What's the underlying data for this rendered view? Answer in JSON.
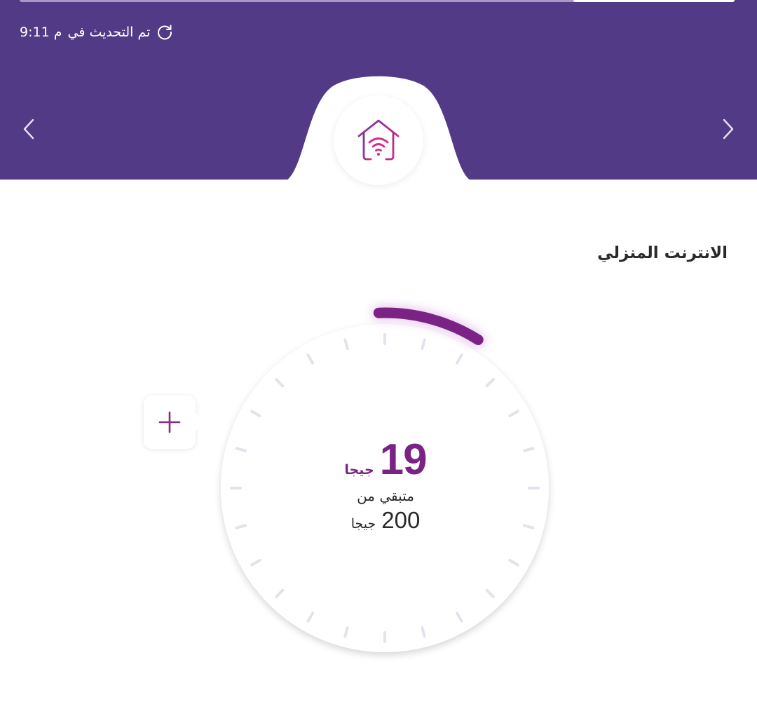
{
  "colors": {
    "brand": "#523a86",
    "accent": "#7a2385",
    "icon_pink": "#c0268f",
    "tick": "#e4e2ec"
  },
  "header": {
    "updated_text": "تم التحديث في",
    "updated_time": "9:11 م",
    "refresh_icon": "refresh-icon",
    "prev_icon": "chevron-left-icon",
    "next_icon": "chevron-right-icon",
    "service_icon": "home-wifi-icon"
  },
  "section": {
    "title": "الانترنت المنزلي"
  },
  "usage": {
    "remaining_value": "19",
    "remaining_unit": "جيجا",
    "remaining_label": "متبقي من",
    "total_value": "200",
    "total_unit": "جيجا",
    "remaining_fraction": 0.095
  },
  "actions": {
    "add_icon": "plus-icon"
  }
}
